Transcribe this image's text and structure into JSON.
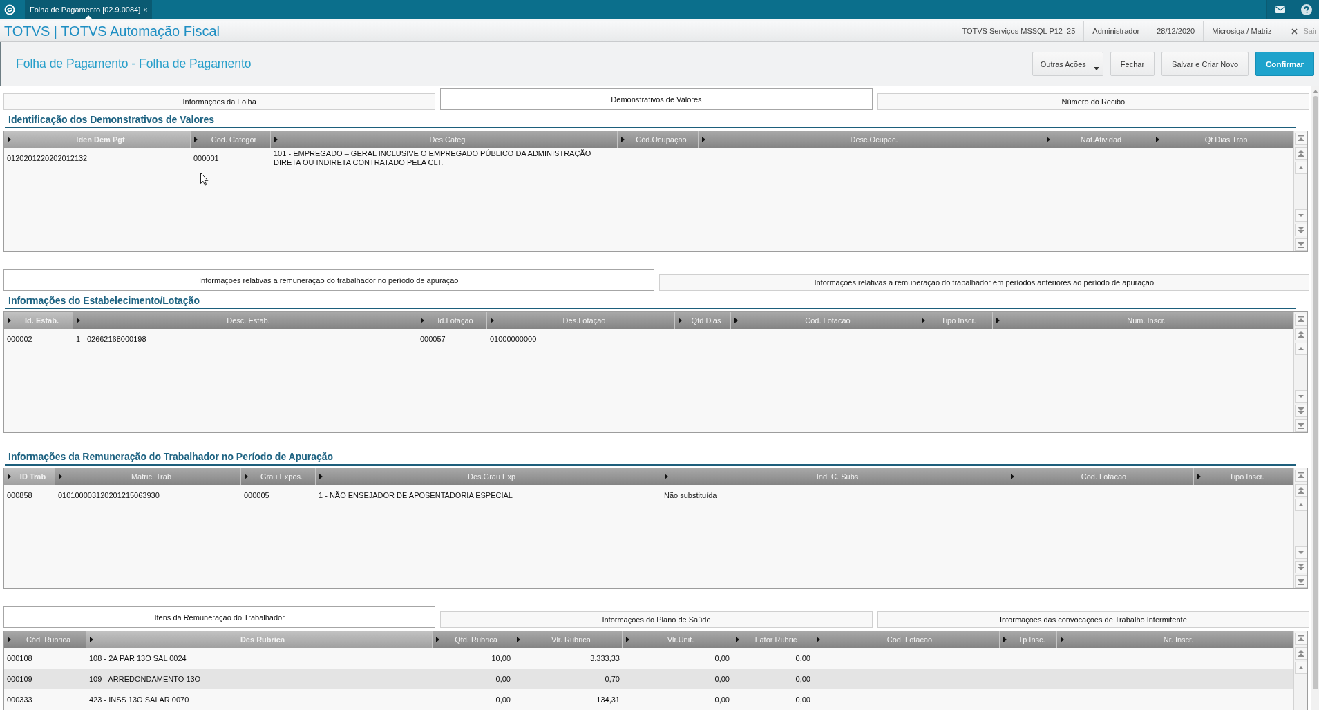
{
  "top_bar": {
    "tabs": [
      {
        "label": "Folha de Pagamento [02.9.0084]",
        "close": "×",
        "selected": true
      }
    ]
  },
  "header": {
    "app_title": "TOTVS | TOTVS Automação Fiscal",
    "info": [
      "TOTVS Serviços MSSQL P12_25",
      "Administrador",
      "28/12/2020",
      "Microsiga / Matriz"
    ],
    "logout": "Sair"
  },
  "form": {
    "title": "Folha de Pagamento - Folha de Pagamento",
    "actions": [
      {
        "label": "Outras Ações",
        "kind": "menu"
      },
      {
        "label": "Fechar",
        "kind": "secondary"
      },
      {
        "label": "Salvar e Criar Novo",
        "kind": "secondary"
      },
      {
        "label": "Confirmar",
        "kind": "primary"
      }
    ]
  },
  "tabs": [
    {
      "label": "Informações da Folha",
      "selected": false
    },
    {
      "label": "Demonstrativos de Valores",
      "selected": true
    },
    {
      "label": "Número do Recibo",
      "selected": false
    }
  ],
  "panels": [
    {
      "kind": "section",
      "title": "Identificação dos Demonstrativos de Valores",
      "grid": {
        "columns": [
          {
            "label": "Iden Dem Pgt",
            "sorted": true
          },
          {
            "label": "Cod. Categor",
            "sorted": false
          },
          {
            "label": "Des Categ",
            "sorted": false
          },
          {
            "label": "Cód.Ocupação",
            "sorted": false
          },
          {
            "label": "Desc.Ocupac.",
            "sorted": false
          },
          {
            "label": "Nat.Atividad",
            "sorted": false
          },
          {
            "label": "Qt Dias Trab",
            "sorted": false
          }
        ],
        "rows": [
          [
            "0120201220202012132",
            "000001",
            "101 - EMPREGADO – GERAL INCLUSIVE O EMPREGADO PÚBLICO DA ADMINISTRAÇÃO DIRETA OU INDIRETA CONTRATADO PELA CLT."
          ]
        ]
      }
    },
    {
      "kind": "tabs",
      "tabs": [
        {
          "label": "Informações relativas a remuneração do trabalhador no período de apuração",
          "selected": true
        },
        {
          "label": "Informações relativas a remuneração do trabalhador em períodos anteriores ao período de apuração",
          "selected": false
        }
      ]
    },
    {
      "kind": "section",
      "title": "Informações do Estabelecimento/Lotação",
      "grid": {
        "columns": [
          {
            "label": "Id. Estab.",
            "sorted": true
          },
          {
            "label": "Desc. Estab.",
            "sorted": false
          },
          {
            "label": "Id.Lotação",
            "sorted": false
          },
          {
            "label": "Des.Lotação",
            "sorted": false
          },
          {
            "label": "Qtd Dias",
            "sorted": false
          },
          {
            "label": "Cod. Lotacao",
            "sorted": false
          },
          {
            "label": "Tipo Inscr.",
            "sorted": false
          },
          {
            "label": "Num. Inscr.",
            "sorted": false
          }
        ],
        "rows": [
          [
            "000002",
            "1 - 02662168000198",
            "000057",
            "01000000000"
          ]
        ]
      }
    },
    {
      "kind": "section",
      "title": "Informações da Remuneração do Trabalhador no Período de Apuração",
      "grid": {
        "columns": [
          {
            "label": "ID Trab",
            "sorted": true
          },
          {
            "label": "Matric. Trab",
            "sorted": false
          },
          {
            "label": "Grau Expos.",
            "sorted": false
          },
          {
            "label": "Des.Grau Exp",
            "sorted": false
          },
          {
            "label": "Ind. C. Subs",
            "sorted": false
          },
          {
            "label": "Cod. Lotacao",
            "sorted": false
          },
          {
            "label": "Tipo Inscr.",
            "sorted": false
          }
        ],
        "rows": [
          [
            "000858",
            "010100003120201215063930",
            "000005",
            "1 - NÃO ENSEJADOR DE APOSENTADORIA ESPECIAL",
            "Não substituída"
          ]
        ]
      }
    },
    {
      "kind": "tabs",
      "tabs": [
        {
          "label": "Itens da Remuneração do Trabalhador",
          "selected": true
        },
        {
          "label": "Informações do Plano de Saúde",
          "selected": false
        },
        {
          "label": "Informações das convocações de Trabalho Intermitente",
          "selected": false
        }
      ]
    },
    {
      "kind": "grid",
      "grid": {
        "columns": [
          {
            "label": "Cód. Rubrica",
            "sorted": false
          },
          {
            "label": "Des Rubrica",
            "sorted": true
          },
          {
            "label": "Qtd. Rubrica",
            "sorted": false
          },
          {
            "label": "Vlr. Rubrica",
            "sorted": false
          },
          {
            "label": "Vlr.Unit.",
            "sorted": false
          },
          {
            "label": "Fator Rubric",
            "sorted": false
          },
          {
            "label": "Cod. Lotacao",
            "sorted": false
          },
          {
            "label": "Tp Insc.",
            "sorted": false
          },
          {
            "label": "Nr. Inscr.",
            "sorted": false
          }
        ],
        "rows": [
          [
            "000108",
            "108 - 2A PAR 13O SAL 0024",
            "10,00",
            "3.333,33",
            "0,00",
            "0,00"
          ],
          [
            "000109",
            "109 - ARREDONDAMENTO 13O",
            "0,00",
            "0,70",
            "0,00",
            "0,00"
          ],
          [
            "000333",
            "423 - INSS 13O SALAR 0070",
            "0,00",
            "134,31",
            "0,00",
            "0,00"
          ]
        ]
      }
    }
  ]
}
